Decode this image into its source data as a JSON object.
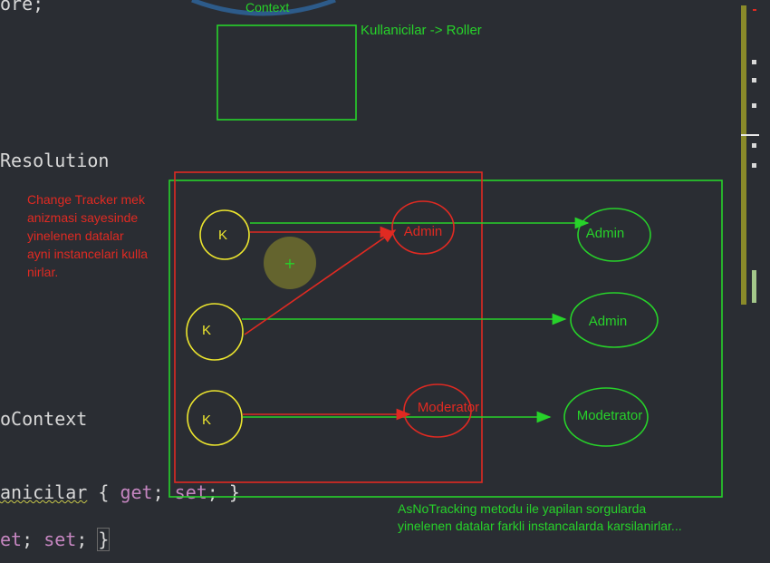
{
  "code_lines": {
    "line1": "ore;",
    "line2": "Resolution",
    "line3": "oContext",
    "line4_ident": "anicilar",
    "line4_rest_open": " { ",
    "line4_get": "get",
    "line4_sep": "; ",
    "line4_set": "set",
    "line4_close": "; }",
    "line5_start": "et",
    "line5_sep": "; ",
    "line5_set": "set",
    "line5_semi": "; ",
    "line5_brace": "}"
  },
  "annotations": {
    "context_label": "Context",
    "relation_label": "Kullanicilar -> Roller",
    "change_tracker_note": [
      "Change Tracker mek",
      "anizmasi sayesinde",
      "yinelenen datalar",
      "ayni instancelari kulla",
      "nirlar."
    ],
    "asnotracking_note": [
      "AsNoTracking metodu ile yapilan sorgularda",
      "yinelenen datalar farkli instancalarda karsilanirlar..."
    ],
    "k_nodes": [
      "K",
      "K",
      "K"
    ],
    "red_roles": [
      "Admin",
      "Moderator"
    ],
    "green_roles": [
      "Admin",
      "Admin",
      "Modetrator"
    ],
    "cursor_plus": "+"
  },
  "colors": {
    "background": "#2a2d33",
    "green": "#27d22a",
    "red": "#e02a22",
    "yellow": "#ece52e",
    "code_text": "#d8d8d8",
    "keyword": "#c586c0"
  }
}
